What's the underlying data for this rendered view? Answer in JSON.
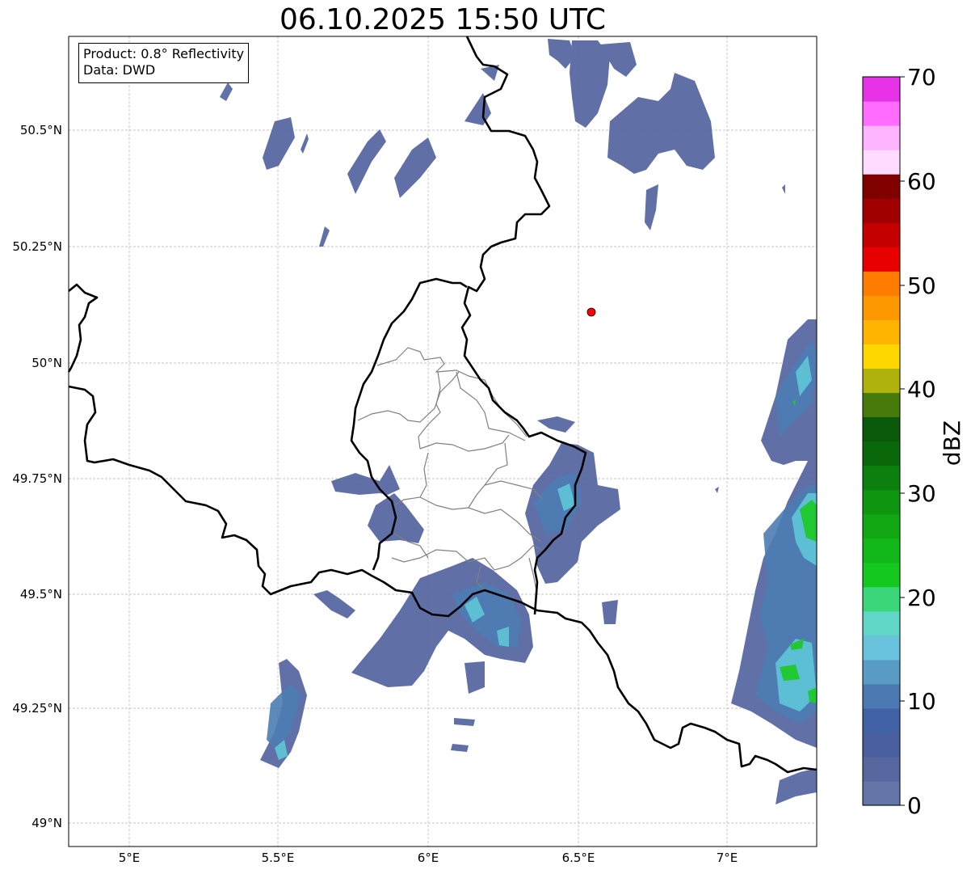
{
  "title": "06.10.2025 15:50 UTC",
  "info_box": {
    "product": "Product: 0.8° Reflectivity",
    "data": "Data: DWD"
  },
  "axes": {
    "x_ticks": [
      "5°E",
      "5.5°E",
      "6°E",
      "6.5°E",
      "7°E"
    ],
    "y_ticks": [
      "50.5°N",
      "50.25°N",
      "50°N",
      "49.75°N",
      "49.5°N",
      "49.25°N",
      "49°N"
    ],
    "grid": true
  },
  "colorbar": {
    "unit": "dBZ",
    "tick_labels": [
      "0",
      "10",
      "20",
      "30",
      "40",
      "50",
      "60",
      "70"
    ],
    "colors": [
      "#6476a8",
      "#5667a0",
      "#4a5fa0",
      "#4262a8",
      "#4b7ab2",
      "#5a9cc6",
      "#68c2dc",
      "#5fd6c6",
      "#3cd67a",
      "#14c820",
      "#12b81a",
      "#12a814",
      "#0e9610",
      "#0c800e",
      "#0a680a",
      "#0a580a",
      "#467a0a",
      "#aeb20a",
      "#fed600",
      "#feb400",
      "#fe9800",
      "#fe7c00",
      "#e80000",
      "#c40000",
      "#a00000",
      "#800000",
      "#ffdcff",
      "#ffb4ff",
      "#ff6cff",
      "#e832e8"
    ]
  },
  "radar_marker": {
    "color": "#ff0000"
  }
}
